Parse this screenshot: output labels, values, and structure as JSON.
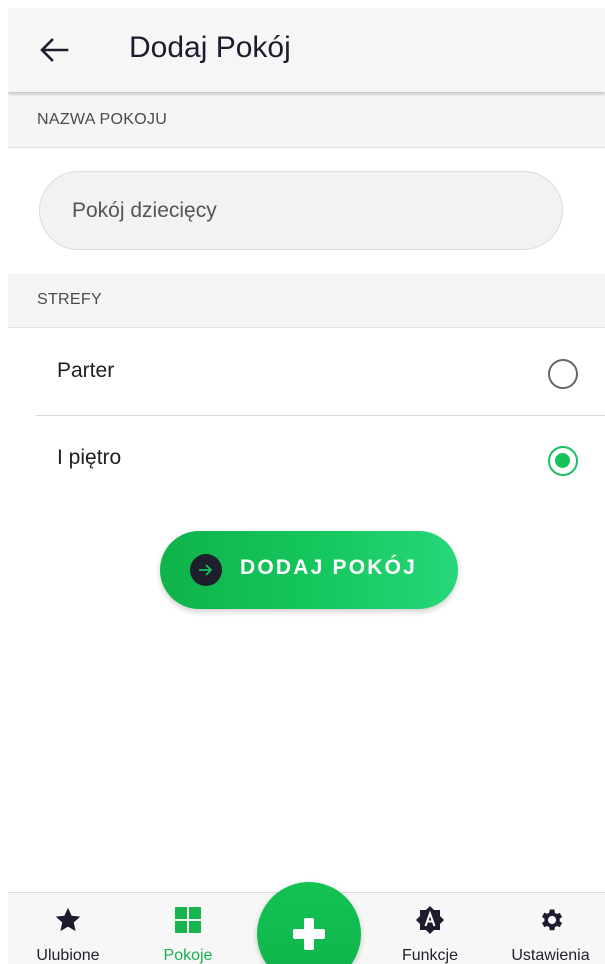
{
  "header": {
    "title": "Dodaj Pokój"
  },
  "sections": {
    "name_header": "NAZWA POKOJU",
    "zones_header": "STREFY"
  },
  "room_name": {
    "value": "Pokój dziecięcy"
  },
  "zones": [
    {
      "label": "Parter",
      "selected": false
    },
    {
      "label": "I piętro",
      "selected": true
    }
  ],
  "add_button": {
    "label": "DODAJ POKÓJ"
  },
  "bottom_nav": {
    "items": [
      {
        "label": "Ulubione",
        "icon": "star-icon"
      },
      {
        "label": "Pokoje",
        "icon": "grid-icon",
        "active": true
      },
      {
        "label": "Funkcje",
        "icon": "automation-badge-icon"
      },
      {
        "label": "Ustawienia",
        "icon": "gear-icon"
      }
    ],
    "fab_icon": "plus-icon"
  },
  "colors": {
    "accent": "#16c25a",
    "text_dark": "#1c1c2e"
  }
}
